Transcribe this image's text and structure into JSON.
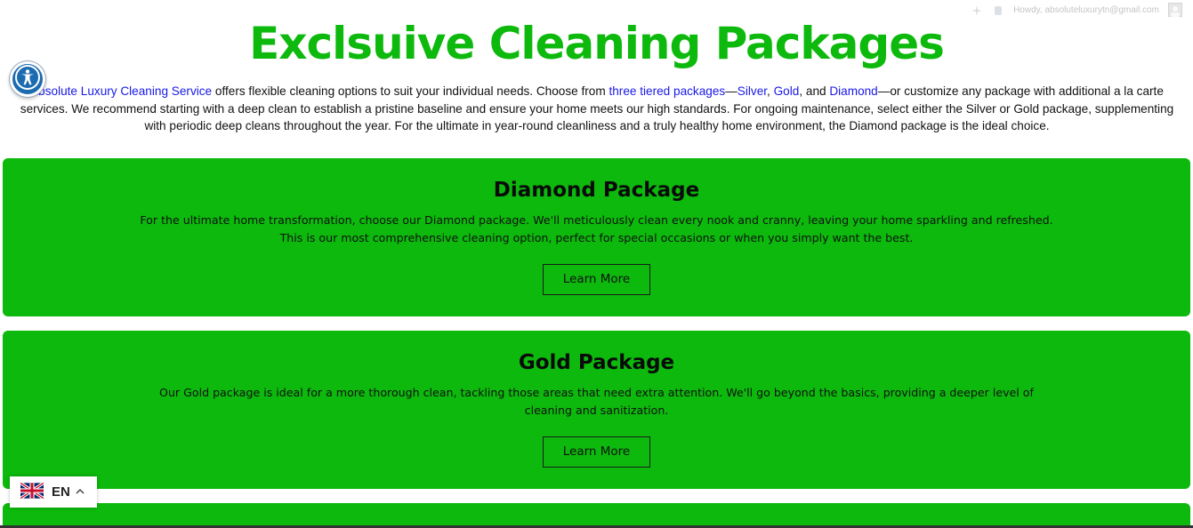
{
  "adminbar": {
    "greeting": "Howdy, absoluteluxurytn@gmail.com"
  },
  "page_title": "Exclsuive Cleaning Packages",
  "intro": {
    "brand_link": "Absolute Luxury Cleaning Service",
    "t1": " offers flexible cleaning options to suit your individual needs. Choose from ",
    "tiers_link": "three tiered packages",
    "t2": "—",
    "silver_link": "Silver",
    "t3": ", ",
    "gold_link": "Gold",
    "t4": ", and ",
    "diamond_link": "Diamond",
    "t5": "—or customize any package with additional a la carte services. We recommend starting with a deep clean to establish a pristine baseline and ensure your home meets our high standards. For ongoing maintenance, select either the Silver or Gold package, supplementing with periodic deep cleans throughout the year. For the ultimate in year-round cleanliness and a truly healthy home environment, the Diamond package is the ideal choice."
  },
  "packages": [
    {
      "title": "Diamond Package",
      "description": "For the ultimate home transformation, choose our Diamond package. We'll meticulously clean every nook and cranny, leaving your home sparkling and refreshed. This is our most comprehensive cleaning option, perfect for special occasions or when you simply want the best.",
      "button": "Learn More"
    },
    {
      "title": "Gold Package",
      "description": "Our Gold package is ideal for a more thorough clean, tackling those areas that need extra attention. We'll go beyond the basics, providing a deeper level of cleaning and sanitization.",
      "button": "Learn More"
    }
  ],
  "language": {
    "code": "EN"
  },
  "colors": {
    "brand_green": "#0cb90c",
    "link_blue": "#1a1ae6",
    "accessibility_blue": "#1c6bb0"
  },
  "icons": [
    "accessibility-icon",
    "uk-flag-icon",
    "chevron-up-icon",
    "sparkle-icon",
    "notification-icon",
    "avatar-icon"
  ]
}
